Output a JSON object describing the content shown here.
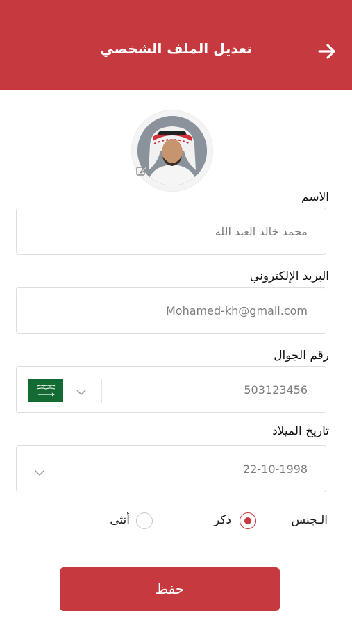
{
  "header": {
    "title": "تعديل الملف الشخصي",
    "back_icon": "arrow-right-icon",
    "color": "#c5393f"
  },
  "profile": {
    "avatar_icon": "avatar",
    "edit_icon": "edit-icon"
  },
  "form": {
    "name_label": "الاسم",
    "name_value": "محمد خالد العبد الله",
    "email_label": "البريد الإلكتروني",
    "email_value": "Mohamed-kh@gmail.com",
    "phone_label": "رقم الجوال",
    "phone_value": "503123456",
    "country_flag_icon": "saudi-flag-icon",
    "birth_label": "تاريخ الميلاد",
    "birth_value": "22-10-1998",
    "gender_label": "الـجنس",
    "gender_male": "ذكر",
    "gender_female": "أنثى",
    "gender_selected": "ذكر"
  },
  "actions": {
    "save_label": "حفظ"
  }
}
